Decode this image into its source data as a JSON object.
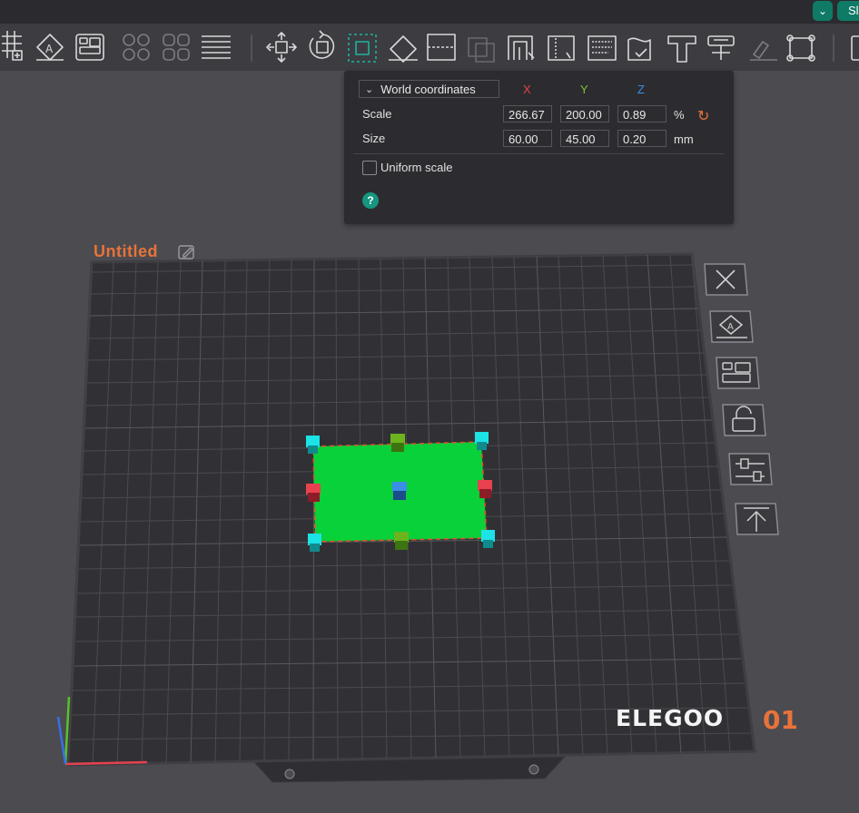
{
  "top_strip": {
    "tab_label": "Sl",
    "dropdown_icon": "chevron-down-icon",
    "accent": "#0f7a66"
  },
  "toolbar": {
    "tools": [
      "grid-add-icon",
      "auto-orient-icon",
      "arrange-icon",
      "split-objects-icon",
      "split-parts-icon",
      "layers-icon",
      "move-icon",
      "rotate-icon",
      "scale-icon",
      "lay-on-face-icon",
      "cut-icon",
      "boolean-icon",
      "support-paint-icon",
      "seam-paint-icon",
      "fuzzy-skin-icon",
      "color-paint-icon",
      "measure-icon",
      "text-icon",
      "emboss-icon",
      "assembly-icon",
      "brim-ears-icon"
    ],
    "active_tool": "scale-icon"
  },
  "scale_panel": {
    "coordinate_system": "World coordinates",
    "axes": {
      "x": "X",
      "y": "Y",
      "z": "Z"
    },
    "axis_colors": {
      "x": "#e8414f",
      "y": "#7ac231",
      "z": "#3a8ee6"
    },
    "scale_label": "Scale",
    "scale": {
      "x": "266.67",
      "y": "200.00",
      "z": "0.89"
    },
    "scale_unit": "%",
    "size_label": "Size",
    "size": {
      "x": "60.00",
      "y": "45.00",
      "z": "0.20"
    },
    "size_unit": "mm",
    "uniform_scale_label": "Uniform scale",
    "uniform_scale_checked": false,
    "help_label": "?"
  },
  "plate": {
    "name": "Untitled",
    "brand": "ELEGOO",
    "number": "01",
    "accent": "#e8733a",
    "object_color": "#08d13a"
  },
  "plate_buttons": [
    "close-icon",
    "auto-orient-plate-icon",
    "arrange-plate-icon",
    "lock-icon",
    "plate-settings-icon",
    "move-to-top-icon"
  ]
}
